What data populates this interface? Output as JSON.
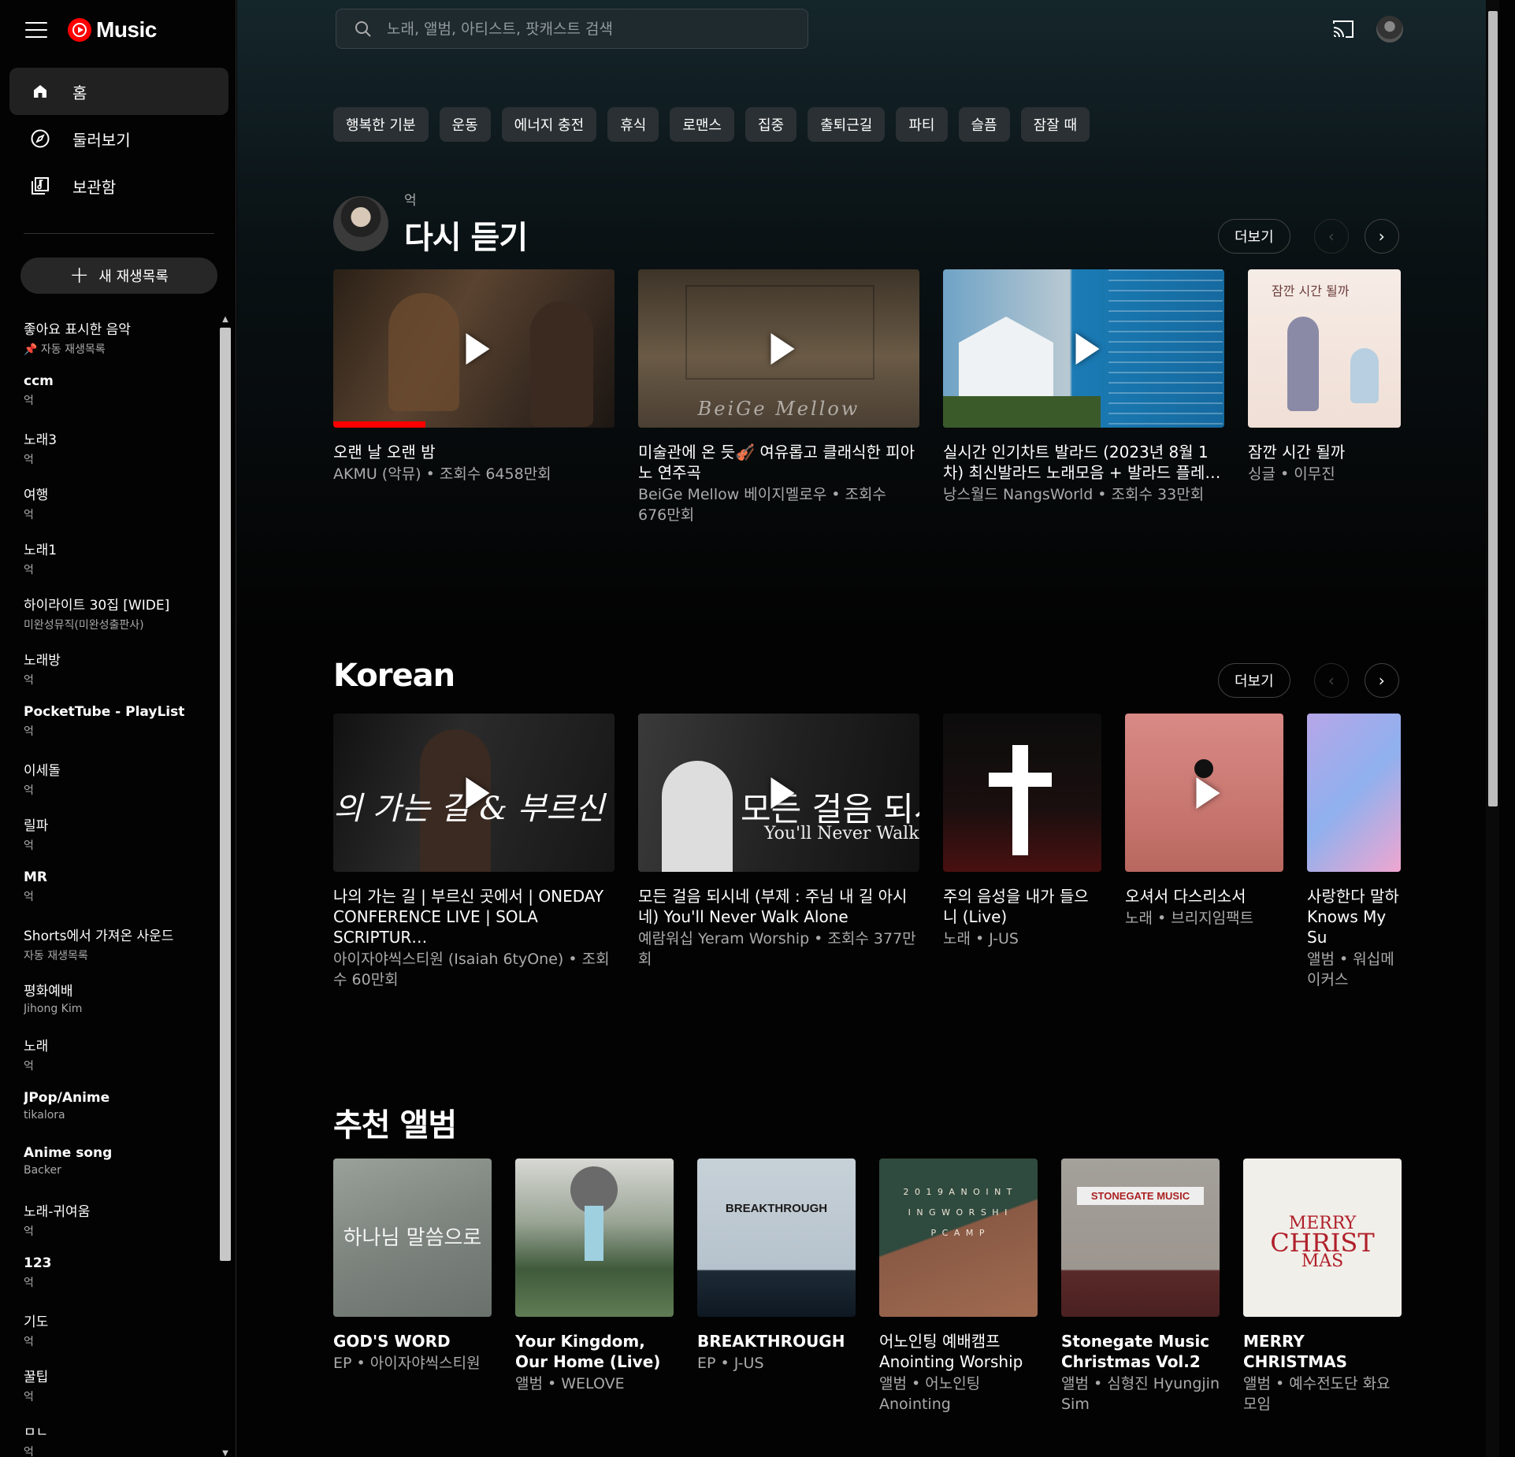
{
  "app": {
    "logo_text": "Music"
  },
  "search": {
    "placeholder": "노래, 앨범, 아티스트, 팟캐스트 검색"
  },
  "nav": [
    {
      "label": "홈",
      "icon": "home-icon",
      "active": true
    },
    {
      "label": "둘러보기",
      "icon": "explore-icon",
      "active": false
    },
    {
      "label": "보관함",
      "icon": "library-icon",
      "active": false
    }
  ],
  "new_playlist": {
    "label": "새 재생목록"
  },
  "playlists": [
    {
      "title": "좋아요 표시한 음악",
      "sub": "📌 자동 재생목록"
    },
    {
      "title": "ccm",
      "sub": "억"
    },
    {
      "title": "노래3",
      "sub": "억"
    },
    {
      "title": "여행",
      "sub": "억"
    },
    {
      "title": "노래1",
      "sub": "억"
    },
    {
      "title": "하이라이트 30집 [WIDE]",
      "sub": "미완성뮤직(미완성출판사)"
    },
    {
      "title": "노래방",
      "sub": "억"
    },
    {
      "title": "PocketTube - PlayList",
      "sub": "억"
    },
    {
      "title": "이세돌",
      "sub": "억"
    },
    {
      "title": "릴파",
      "sub": "억"
    },
    {
      "title": "MR",
      "sub": "억"
    },
    {
      "title": "Shorts에서 가져온 사운드",
      "sub": "자동 재생목록"
    },
    {
      "title": "평화예배",
      "sub": "Jihong Kim"
    },
    {
      "title": "노래",
      "sub": "억"
    },
    {
      "title": "JPop/Anime",
      "sub": "tikalora"
    },
    {
      "title": "Anime song",
      "sub": "Backer"
    },
    {
      "title": "노래-귀여움",
      "sub": "억"
    },
    {
      "title": "123",
      "sub": "억"
    },
    {
      "title": "기도",
      "sub": "억"
    },
    {
      "title": "꿀팁",
      "sub": "억"
    },
    {
      "title": "ㅁㄴ",
      "sub": "억"
    }
  ],
  "chips": [
    "행복한 기분",
    "운동",
    "에너지 충전",
    "휴식",
    "로맨스",
    "집중",
    "출퇴근길",
    "파티",
    "슬픔",
    "잠잘 때"
  ],
  "listen_again": {
    "user": "억",
    "title": "다시 듣기",
    "more": "더보기",
    "cards": [
      {
        "title": "오랜 날 오랜 밤",
        "sub": "AKMU (악뮤) • 조회수 6458만회"
      },
      {
        "title": "미술관에 온 듯🎻 여유롭고 클래식한 피아노 연주곡",
        "sub": "BeiGe Mellow 베이지멜로우 • 조회수 676만회"
      },
      {
        "title": "실시간 인기차트 발라드 (2023년 8월 1차) 최신발라드 노래모음 + 발라드 플레…",
        "sub": "낭스월드 NangsWorld • 조회수 33만회"
      },
      {
        "title": "잠깐 시간 될까",
        "sub": "싱글 • 이무진"
      }
    ]
  },
  "korean": {
    "title": "Korean",
    "more": "더보기",
    "cards": [
      {
        "title": "나의 가는 길 | 부르신 곳에서 | ONEDAY CONFERENCE LIVE | SOLA SCRIPTUR…",
        "sub": "아이자야씩스티원 (Isaiah 6tyOne) • 조회수 60만회"
      },
      {
        "title": "모든 걸음 되시네 (부제 : 주님 내 길 아시네) You'll Never Walk Alone",
        "sub": "예람워십 Yeram Worship • 조회수 377만회"
      },
      {
        "title": "주의 음성을 내가 들으니 (Live)",
        "sub": "노래 • J-US"
      },
      {
        "title": "오셔서 다스리소서",
        "sub": "노래 • 브리지임팩트"
      },
      {
        "title": "사랑한다 말하 Knows My Su",
        "sub": "앨범 • 워십메이커스"
      }
    ]
  },
  "albums": {
    "title": "추천 앨범",
    "cards": [
      {
        "title": "GOD'S WORD",
        "sub": "EP • 아이자야씩스티원"
      },
      {
        "title": "Your Kingdom, Our Home (Live)",
        "sub": "앨범 • WELOVE"
      },
      {
        "title": "BREAKTHROUGH",
        "sub": "EP • J-US"
      },
      {
        "title": "어노인팅 예배캠프 Anointing Worship",
        "sub": "앨범 • 어노인팅 Anointing"
      },
      {
        "title": "Stonegate Music Christmas Vol.2",
        "sub": "앨범 • 심형진 Hyungjin Sim"
      },
      {
        "title": "MERRY CHRISTMAS",
        "sub": "앨범 • 예수전도단 화요모임"
      }
    ]
  },
  "art_text": {
    "beige": "BeiGe Mellow",
    "moment": "잠깐 시간 될까",
    "worship_line1": "모든 걸음 되시",
    "worship_line2": "You'll Never Walk Al",
    "path_text": "의 가는 길 & 부르신 곳에",
    "breakthrough": "BREAKTHROUGH",
    "stonegate": "STONEGATE MUSIC",
    "merry": "MERRY",
    "christ": "CHRIST",
    "mas": "MAS",
    "anointing": "2 0 1 9  A N O I N T I N G  W O R S H I P  C A M P",
    "godsword": "하나님 말씀으로"
  }
}
